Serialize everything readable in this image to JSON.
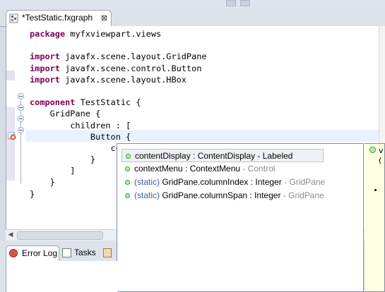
{
  "editor_tab": {
    "title": "*TestStatic.fxgraph",
    "close_glyph": "⊠"
  },
  "code_lines": [
    {
      "kw": "package",
      "rest": " myfxviewpart.views"
    },
    {
      "kw": "",
      "rest": ""
    },
    {
      "kw": "import",
      "rest": " javafx.scene.layout.GridPane"
    },
    {
      "kw": "import",
      "rest": " javafx.scene.control.Button"
    },
    {
      "kw": "import",
      "rest": " javafx.scene.layout.HBox"
    },
    {
      "kw": "",
      "rest": ""
    },
    {
      "kw": "component",
      "rest": " TestStatic {"
    },
    {
      "kw": "",
      "rest": "    GridPane {"
    },
    {
      "kw": "",
      "rest": "        children : ["
    },
    {
      "kw": "",
      "rest": "            Button {"
    },
    {
      "kw": "",
      "rest": "                co"
    },
    {
      "kw": "",
      "rest": "            }"
    },
    {
      "kw": "",
      "rest": "        ]"
    },
    {
      "kw": "",
      "rest": "    }"
    },
    {
      "kw": "",
      "rest": "}"
    }
  ],
  "completion": {
    "items": [
      {
        "prefix": "",
        "main": "contentDisplay : ContentDisplay - Labeled",
        "owner": "",
        "selected": true
      },
      {
        "prefix": "",
        "main": "contextMenu : ContextMenu",
        "owner": " - Control",
        "selected": false
      },
      {
        "prefix": "(static) ",
        "main": "GridPane.columnIndex : Integer",
        "owner": " - GridPane",
        "selected": false
      },
      {
        "prefix": "(static) ",
        "main": "GridPane.columnSpan : Integer",
        "owner": " - GridPane",
        "selected": false
      }
    ]
  },
  "doc_popup": {
    "line1": "v",
    "line2": "("
  },
  "bottom_tabs": {
    "error_log": "Error Log",
    "tasks": "Tasks"
  },
  "colors": {
    "keyword": "#7f0055",
    "current_line": "#e8f2fe",
    "popup_dim": "#8a8a8a",
    "static_prefix": "#3b5ea8"
  },
  "icons": [
    "fxgraph-file-icon",
    "close-icon",
    "fold-toggle-icon",
    "error-marker-icon",
    "property-icon",
    "error-log-icon",
    "tasks-icon"
  ]
}
